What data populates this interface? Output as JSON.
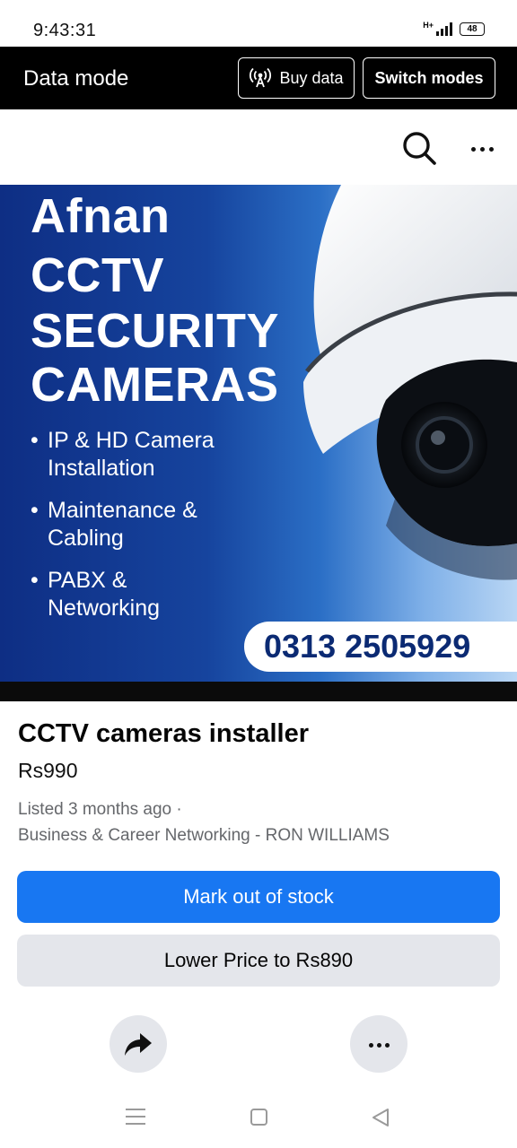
{
  "status_bar": {
    "time": "9:43:31",
    "network": "H+",
    "battery": "48"
  },
  "data_mode_bar": {
    "title": "Data mode",
    "buy_data_label": "Buy data",
    "switch_modes_label": "Switch modes"
  },
  "top_actions": {
    "icons": [
      "search-icon",
      "more-icon"
    ]
  },
  "banner": {
    "title_lines": [
      "Afnan",
      "CCTV",
      "SECURITY",
      "CAMERAS"
    ],
    "bullets": [
      {
        "line1": "IP & HD Camera",
        "line2": "Installation"
      },
      {
        "line1": "Maintenance &",
        "line2": "Cabling"
      },
      {
        "line1": "PABX &",
        "line2": "Networking"
      }
    ],
    "phone": "0313 2505929"
  },
  "listing": {
    "title": "CCTV cameras installer",
    "price": "Rs990",
    "listed": "Listed 3 months ago ·",
    "category": "Business & Career Networking - RON WILLIAMS"
  },
  "actions": {
    "mark_out_of_stock": "Mark out of stock",
    "lower_price": "Lower Price to Rs890"
  },
  "colors": {
    "primary": "#1877f2",
    "secondary_bg": "#e4e6eb",
    "meta_text": "#65676b",
    "data_bar": "#000000"
  }
}
